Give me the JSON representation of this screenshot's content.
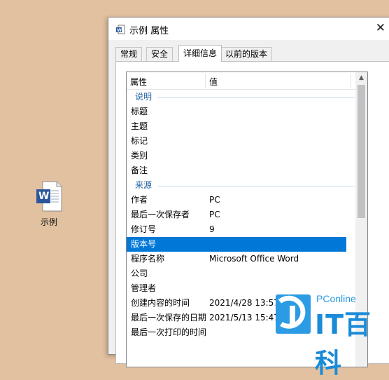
{
  "desktop": {
    "icon_label": "示例",
    "icon_letter": "W"
  },
  "window": {
    "title": "示例 属性",
    "close": "✕"
  },
  "tabs": [
    {
      "label": "常规"
    },
    {
      "label": "安全"
    },
    {
      "label": "详细信息",
      "active": true
    },
    {
      "label": "以前的版本"
    }
  ],
  "table": {
    "headers": {
      "property": "属性",
      "value": "值"
    },
    "groups": [
      {
        "label": "说明",
        "rows": [
          {
            "key": "标题",
            "value": ""
          },
          {
            "key": "主题",
            "value": ""
          },
          {
            "key": "标记",
            "value": ""
          },
          {
            "key": "类别",
            "value": ""
          },
          {
            "key": "备注",
            "value": ""
          }
        ]
      },
      {
        "label": "来源",
        "rows": [
          {
            "key": "作者",
            "value": "PC"
          },
          {
            "key": "最后一次保存者",
            "value": "PC"
          },
          {
            "key": "修订号",
            "value": "9"
          },
          {
            "key": "版本号",
            "value": "",
            "selected": true
          },
          {
            "key": "程序名称",
            "value": "Microsoft Office Word"
          },
          {
            "key": "公司",
            "value": ""
          },
          {
            "key": "管理者",
            "value": ""
          },
          {
            "key": "创建内容的时间",
            "value": "2021/4/28 13:57"
          },
          {
            "key": "最后一次保存的日期",
            "value": "2021/5/13 15:47"
          },
          {
            "key": "最后一次打印的时间",
            "value": ""
          }
        ]
      }
    ]
  },
  "watermark": {
    "brand": "PConline",
    "text": "IT百科"
  },
  "colors": {
    "selection": "#0078d7",
    "group_text": "#1f5fa0",
    "desktop": "#e2c1a0",
    "word_blue": "#2b579a"
  }
}
